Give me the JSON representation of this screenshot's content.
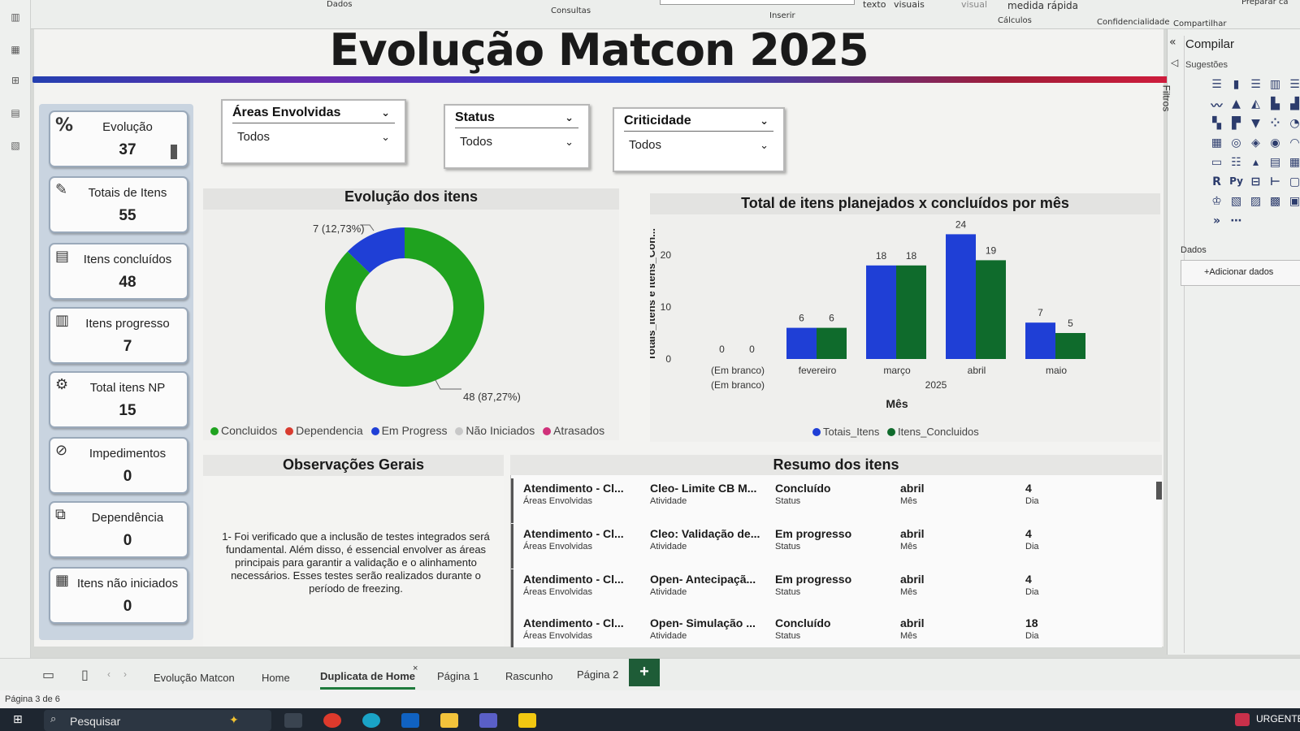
{
  "ribbon": {
    "groups": [
      "Dados",
      "Consultas",
      "Inserir",
      "Cálculos",
      "Confidencialidade",
      "Compartilhar"
    ],
    "items": [
      "texto",
      "visuais",
      "visual",
      "medida rápida",
      "Preparar ca"
    ]
  },
  "report": {
    "title": "Evolução Matcon 2025"
  },
  "kpis": [
    {
      "label": "Evolução",
      "value": "37",
      "icon": "percent-icon",
      "glyph": "%"
    },
    {
      "label": "Totais de Itens",
      "value": "55",
      "icon": "edit-list-icon",
      "glyph": "✎"
    },
    {
      "label": "Itens concluídos",
      "value": "48",
      "icon": "clipboard-icon",
      "glyph": "▤"
    },
    {
      "label": "Itens progresso",
      "value": "7",
      "icon": "bar-chart-icon",
      "glyph": "▥"
    },
    {
      "label": "Total itens NP",
      "value": "15",
      "icon": "gear-check-icon",
      "glyph": "⚙"
    },
    {
      "label": "Impedimentos",
      "value": "0",
      "icon": "block-icon",
      "glyph": "⊘"
    },
    {
      "label": "Dependência",
      "value": "0",
      "icon": "link-icon",
      "glyph": "⧉"
    },
    {
      "label": "Itens não iniciados",
      "value": "0",
      "icon": "document-icon",
      "glyph": "▦"
    }
  ],
  "slicers": [
    {
      "title": "Áreas Envolvidas",
      "value": "Todos"
    },
    {
      "title": "Status",
      "value": "Todos"
    },
    {
      "title": "Criticidade",
      "value": "Todos"
    }
  ],
  "donut": {
    "title": "Evolução dos itens",
    "label_small": "7 (12,73%)",
    "label_large": "48 (87,27%)",
    "legend": [
      {
        "name": "Concluidos",
        "color": "#1fa21f"
      },
      {
        "name": "Dependencia",
        "color": "#d83b2f"
      },
      {
        "name": "Em Progress",
        "color": "#1f3fd6"
      },
      {
        "name": "Não Iniciados",
        "color": "#c8c8c8"
      },
      {
        "name": "Atrasados",
        "color": "#d0317a"
      }
    ]
  },
  "chart_data": [
    {
      "type": "pie",
      "title": "Evolução dos itens",
      "slices": [
        {
          "name": "Concluidos",
          "value": 48,
          "percent": 87.27
        },
        {
          "name": "Em Progress",
          "value": 7,
          "percent": 12.73
        }
      ]
    },
    {
      "type": "bar",
      "title": "Total de itens planejados x concluídos por mês",
      "xlabel": "Mês",
      "ylabel": "Totais_Itens e Itens_Con...",
      "categories": [
        "(Em branco)",
        "fevereiro",
        "março",
        "abril",
        "maio"
      ],
      "category_sub": [
        "(Em branco)",
        "",
        "",
        "",
        ""
      ],
      "group_label": "2025",
      "series": [
        {
          "name": "Totais_Itens",
          "color": "#1f3fd6",
          "values": [
            0,
            6,
            18,
            24,
            7
          ]
        },
        {
          "name": "Itens_Concluidos",
          "color": "#0f6b2c",
          "values": [
            0,
            6,
            18,
            19,
            5
          ]
        }
      ],
      "yticks": [
        "0",
        "10",
        "20"
      ],
      "ylim": [
        0,
        26
      ]
    }
  ],
  "bar_chart": {
    "title": "Total de itens planejados x concluídos por mês",
    "xlabel": "Mês",
    "ylabel": "Totais_Itens e Itens_Con...",
    "group_label": "2025",
    "legend": [
      {
        "name": "Totais_Itens",
        "color": "#1f3fd6"
      },
      {
        "name": "Itens_Concluidos",
        "color": "#0f6b2c"
      }
    ]
  },
  "observacoes": {
    "title": "Observações Gerais",
    "text": "1- Foi verificado que a inclusão de testes integrados será fundamental. Além disso, é essencial envolver as áreas principais para garantir a validação e o alinhamento necessários. Esses testes serão realizados durante o período de freezing."
  },
  "resumo": {
    "title": "Resumo dos itens",
    "field_labels": [
      "Áreas Envolvidas",
      "Atividade",
      "Status",
      "Mês",
      "Dia"
    ],
    "rows": [
      [
        "Atendimento - Cl...",
        "Cleo- Limite CB M...",
        "Concluído",
        "abril",
        "4"
      ],
      [
        "Atendimento - Cl...",
        "Cleo: Validação de...",
        "Em progresso",
        "abril",
        "4"
      ],
      [
        "Atendimento - Cl...",
        "Open- Antecipaçã...",
        "Em progresso",
        "abril",
        "4"
      ],
      [
        "Atendimento - Cl...",
        "Open- Simulação ...",
        "Concluído",
        "abril",
        "18"
      ]
    ]
  },
  "right_pane": {
    "filters_label": "Filtros",
    "header": "Compilar",
    "suggestions": "Sugestões",
    "data_label": "Dados",
    "add_data": "+Adicionar dados"
  },
  "tabs": [
    "Evolução Matcon",
    "Home",
    "Duplicata de Home",
    "Página 1",
    "Rascunho",
    "Página 2"
  ],
  "active_tab": "Duplicata de Home",
  "add_tab": "+",
  "status": "Página 3 de 6",
  "taskbar": {
    "search": "Pesquisar",
    "notification": "URGENTE"
  }
}
